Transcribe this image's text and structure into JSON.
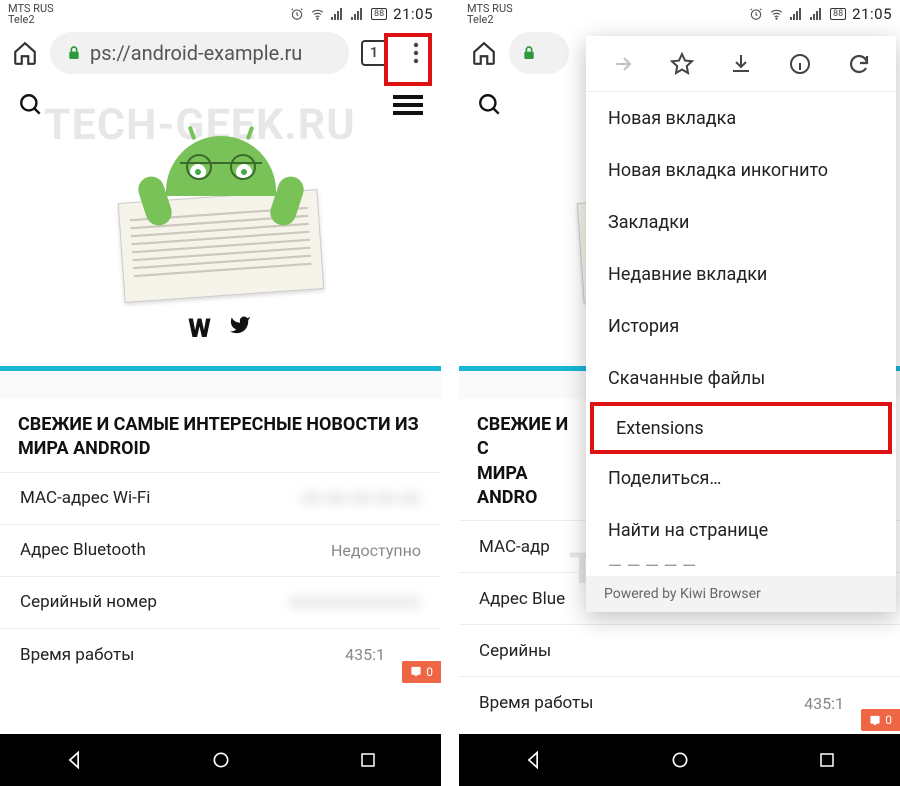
{
  "status": {
    "carrier1": "MTS RUS",
    "carrier2": "Tele2",
    "battery": "88",
    "time": "21:05"
  },
  "url": {
    "display": "ps://android-example.ru",
    "tab_count": "1"
  },
  "watermark": "TECH-GEEK.RU",
  "news_heading": "СВЕЖИЕ И САМЫЕ ИНТЕРЕСНЫЕ НОВОСТИ ИЗ МИРА ANDROID",
  "news_heading_cut": "СВЕЖИЕ И С\nМИРА ANDRO",
  "rows": [
    {
      "label": "MAC-адрес Wi-Fi",
      "value": "00:00:00:00:00",
      "blur": true
    },
    {
      "label": "Адрес Bluetooth",
      "value": "Недоступно",
      "blur": false
    },
    {
      "label": "Серийный номер",
      "value": "XXXXXXXXXXXX",
      "blur": true
    },
    {
      "label": "Время работы",
      "value": "435:1",
      "blur": false,
      "badge": "0"
    }
  ],
  "rows_cut": [
    {
      "label": "MAC-адр"
    },
    {
      "label": "Адрес Blue"
    },
    {
      "label": "Серийны"
    },
    {
      "label": "Время работы",
      "value": "435:1",
      "badge": "0"
    }
  ],
  "menu": {
    "items": [
      "Новая вкладка",
      "Новая вкладка инкогнито",
      "Закладки",
      "Недавние вкладки",
      "История",
      "Скачанные файлы",
      "Extensions",
      "Поделиться…",
      "Найти на странице"
    ],
    "highlight_index": 6,
    "footer": "Powered by Kiwi Browser"
  }
}
